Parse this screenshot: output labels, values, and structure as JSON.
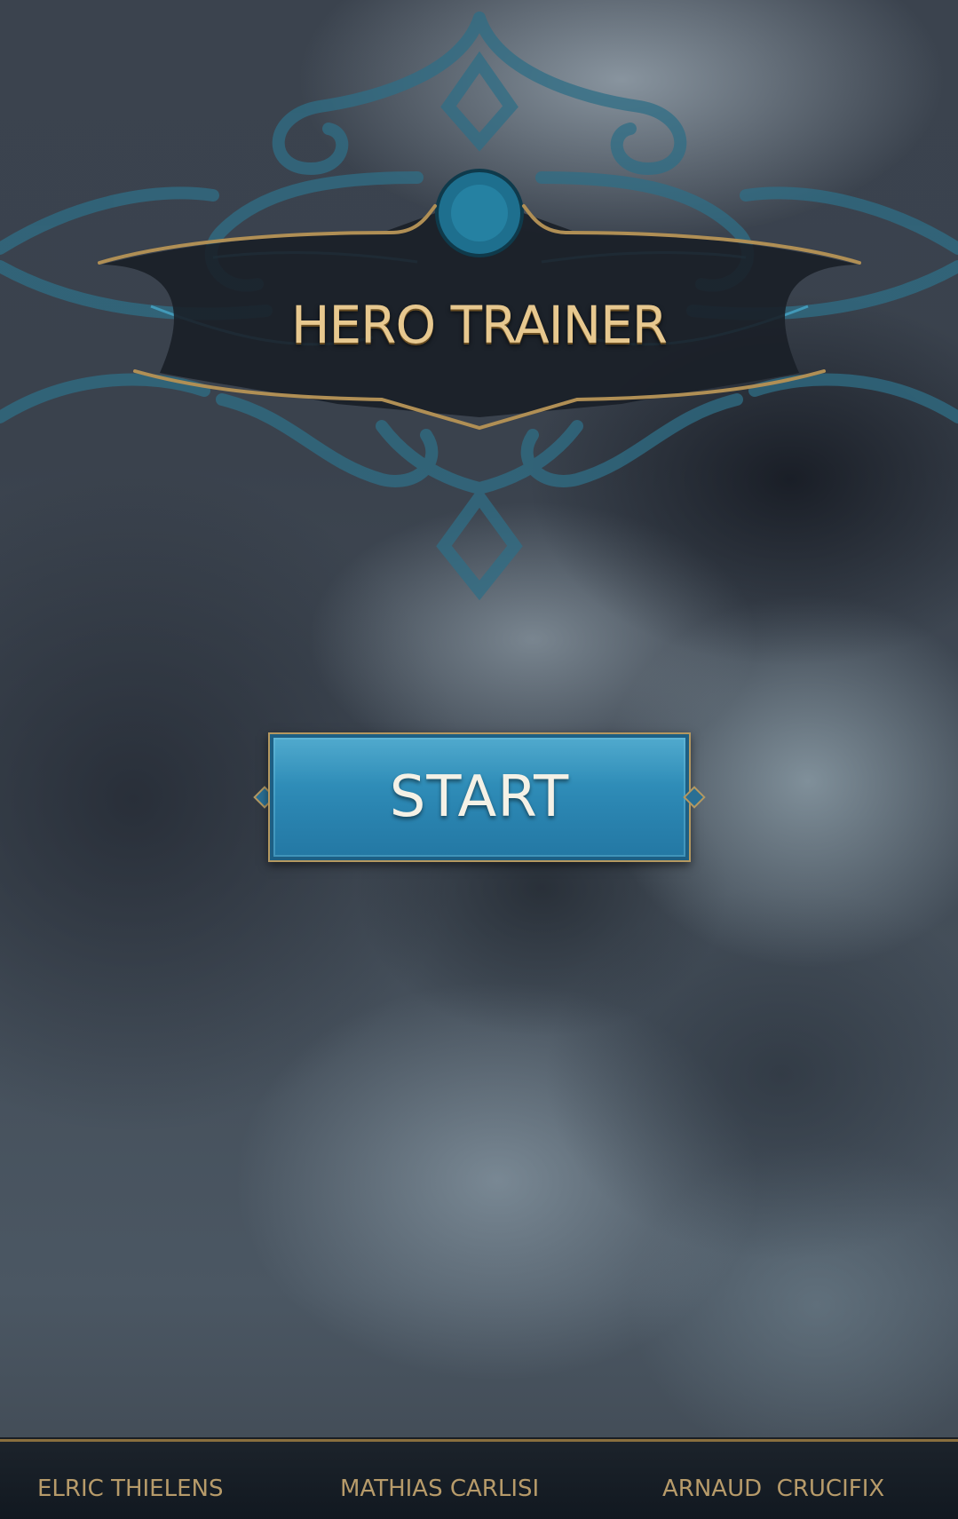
{
  "app": {
    "title": "HERO TRAINER"
  },
  "main": {
    "start_button_label": "START"
  },
  "footer": {
    "credits": [
      "ELRIC THIELENS",
      "MATHIAS CARLISI",
      "ARNAUD  CRUCIFIX"
    ]
  },
  "colors": {
    "title_gold": "#e7c88f",
    "button_blue": "#2b86b2",
    "frame_gold": "#b59860",
    "ornament_teal": "#2f6e86",
    "footer_bg": "#151c24"
  }
}
